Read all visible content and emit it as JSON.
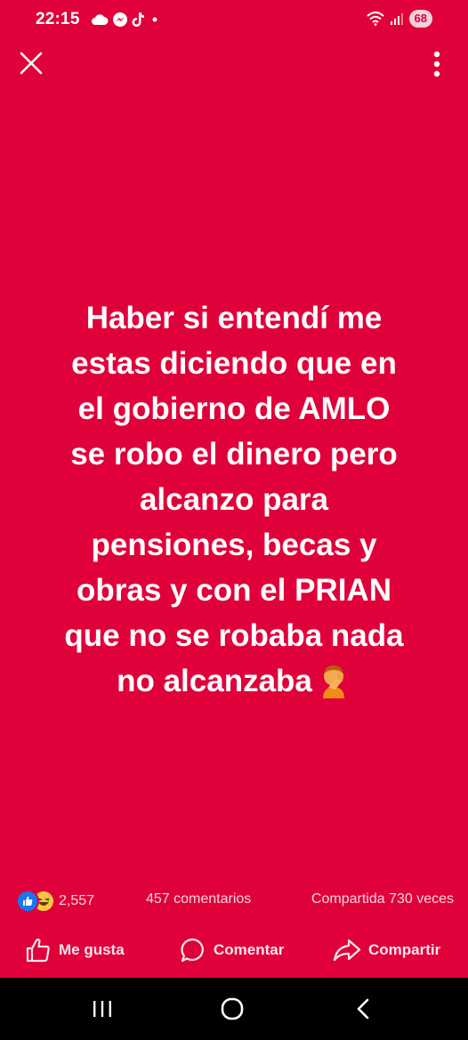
{
  "status_bar": {
    "time": "22:15",
    "battery": "68",
    "left_icons": [
      "cloud-icon",
      "messenger-icon",
      "tiktok-icon",
      "dot-icon"
    ],
    "right_icons": [
      "wifi-icon",
      "signal-icon"
    ]
  },
  "top_bar": {
    "close_icon": "close-icon",
    "more_icon": "more-vertical-icon"
  },
  "post": {
    "text": "Haber si entendí me\nestas diciendo que en\nel gobierno de AMLO\nse robo el dinero pero\nalcanzo para\npensiones, becas y\nobras y con el PRIAN\nque no se robaba nada\nno alcanzaba",
    "emoji": "facepalm-emoji",
    "background_color": "#e0003a"
  },
  "stats": {
    "reaction_count": "2,557",
    "comments": "457 comentarios",
    "shares": "Compartida 730 veces",
    "reaction_icons": [
      "like-reaction-icon",
      "haha-reaction-icon"
    ]
  },
  "actions": {
    "like": "Me gusta",
    "comment": "Comentar",
    "share": "Compartir"
  },
  "nav_bar": {
    "buttons": [
      "recent-apps-icon",
      "home-icon",
      "back-icon"
    ]
  }
}
